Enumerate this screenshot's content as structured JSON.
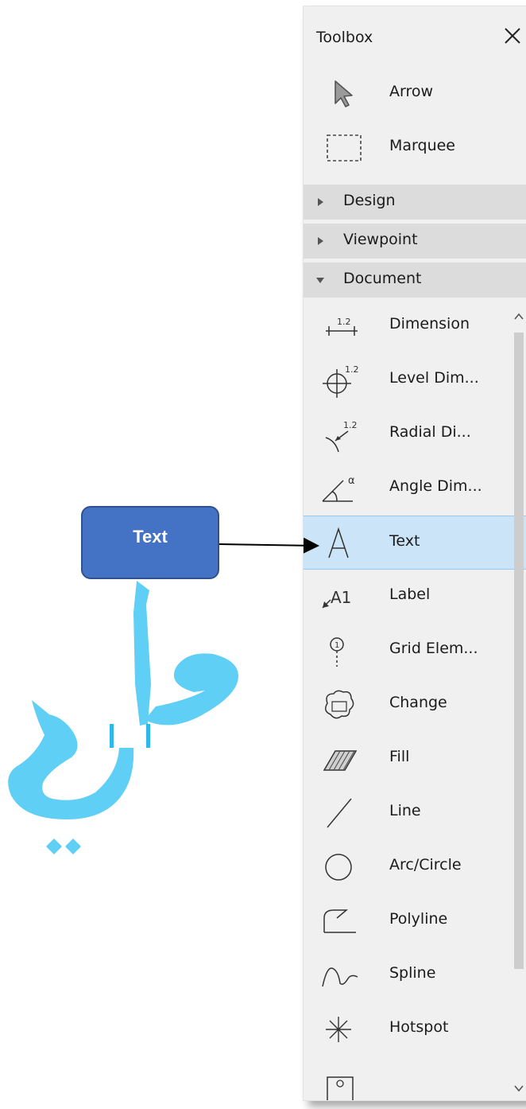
{
  "toolbox": {
    "title": "Toolbox",
    "close_icon": "close-icon",
    "top_items": [
      {
        "label": "Arrow",
        "icon": "arrow-icon"
      },
      {
        "label": "Marquee",
        "icon": "marquee-icon"
      }
    ],
    "sections": [
      {
        "label": "Design",
        "state": "collapsed"
      },
      {
        "label": "Viewpoint",
        "state": "collapsed"
      },
      {
        "label": "Document",
        "state": "expanded"
      }
    ],
    "document_items": [
      {
        "label": "Dimension",
        "icon": "dimension-icon"
      },
      {
        "label": "Level Dim...",
        "icon": "level-dimension-icon"
      },
      {
        "label": "Radial Di...",
        "icon": "radial-dimension-icon"
      },
      {
        "label": "Angle Dim...",
        "icon": "angle-dimension-icon"
      },
      {
        "label": "Text",
        "icon": "text-tool-icon",
        "selected": true
      },
      {
        "label": "Label",
        "icon": "label-icon"
      },
      {
        "label": "Grid Elem...",
        "icon": "grid-element-icon"
      },
      {
        "label": "Change",
        "icon": "change-icon"
      },
      {
        "label": "Fill",
        "icon": "fill-icon"
      },
      {
        "label": "Line",
        "icon": "line-icon"
      },
      {
        "label": "Arc/Circle",
        "icon": "arc-circle-icon"
      },
      {
        "label": "Polyline",
        "icon": "polyline-icon"
      },
      {
        "label": "Spline",
        "icon": "spline-icon"
      },
      {
        "label": "Hotspot",
        "icon": "hotspot-icon"
      }
    ],
    "selection_color": "#cce4f7",
    "section_color": "#dcdcdc"
  },
  "annotation": {
    "callout_text": "Text",
    "callout_color": "#4472c4",
    "calligraphy_text": "علي",
    "calligraphy_color": "#5fcff5"
  }
}
